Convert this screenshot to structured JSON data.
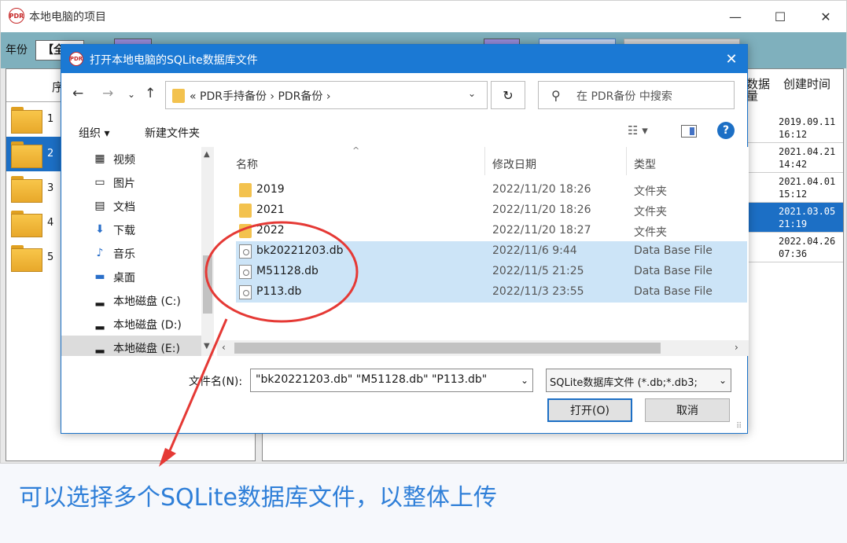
{
  "app": {
    "logo_text": "PDR",
    "title": "本地电脑的项目",
    "min_glyph": "—",
    "max_glyph": "☐",
    "close_glyph": "✕",
    "toolbar": {
      "year_label": "年份",
      "year_button": "【全"
    },
    "left_table": {
      "header_seq": "序",
      "rows": [
        {
          "num": "1"
        },
        {
          "num": "2"
        },
        {
          "num": "3"
        },
        {
          "num": "4"
        },
        {
          "num": "5"
        }
      ]
    },
    "right_table": {
      "header_col1": "数据量",
      "header_col2": "创建时间",
      "rows": [
        {
          "line1": "2019.09.11",
          "line2": "16:12"
        },
        {
          "line1": "2021.04.21",
          "line2": "14:42"
        },
        {
          "line1": "2021.04.01",
          "line2": "15:12"
        },
        {
          "line1": "2021.03.05",
          "line2": "21:19"
        },
        {
          "line1": "2022.04.26",
          "line2": "07:36"
        }
      ]
    }
  },
  "dialog": {
    "logo_text": "PDR",
    "title": "打开本地电脑的SQLite数据库文件",
    "close_glyph": "✕",
    "nav": {
      "back": "←",
      "forward": "→",
      "recent": "⌄",
      "up": "↑",
      "path": "«  PDR手持备份  ›  PDR备份  ›",
      "path_drop": "⌄",
      "refresh": "↻",
      "search_icon": "⚲",
      "search_placeholder": "在 PDR备份 中搜索"
    },
    "commands": {
      "organize": "组织 ▾",
      "new_folder": "新建文件夹",
      "view": "☷ ▾",
      "help": "?"
    },
    "nav_pane": {
      "scroll_up": "▲",
      "scroll_down": "▼",
      "items": [
        {
          "icon": "▦",
          "label": "视频"
        },
        {
          "icon": "▭",
          "label": "图片"
        },
        {
          "icon": "▤",
          "label": "文档"
        },
        {
          "icon": "⬇",
          "label": "下载"
        },
        {
          "icon": "♪",
          "label": "音乐"
        },
        {
          "icon": "▬",
          "label": "桌面"
        },
        {
          "icon": "▂",
          "label": "本地磁盘 (C:)"
        },
        {
          "icon": "▂",
          "label": "本地磁盘 (D:)"
        },
        {
          "icon": "▂",
          "label": "本地磁盘 (E:)"
        }
      ]
    },
    "file_list": {
      "sort_arrow": "^",
      "col_name": "名称",
      "col_date": "修改日期",
      "col_type": "类型",
      "rows": [
        {
          "name": "2019",
          "date": "2022/11/20 18:26",
          "type": "文件夹",
          "kind": "folder",
          "selected": false
        },
        {
          "name": "2021",
          "date": "2022/11/20 18:26",
          "type": "文件夹",
          "kind": "folder",
          "selected": false
        },
        {
          "name": "2022",
          "date": "2022/11/20 18:27",
          "type": "文件夹",
          "kind": "folder",
          "selected": false
        },
        {
          "name": "bk20221203.db",
          "date": "2022/11/6 9:44",
          "type": "Data Base File",
          "kind": "file",
          "selected": true
        },
        {
          "name": "M51128.db",
          "date": "2022/11/5 21:25",
          "type": "Data Base File",
          "kind": "file",
          "selected": true
        },
        {
          "name": "P113.db",
          "date": "2022/11/3 23:55",
          "type": "Data Base File",
          "kind": "file",
          "selected": true
        }
      ]
    },
    "hscroll": {
      "left": "‹",
      "right": "›"
    },
    "filename_label": "文件名(N):",
    "filename_value": "\"bk20221203.db\" \"M51128.db\" \"P113.db\"",
    "filename_drop": "⌄",
    "filter_value": "SQLite数据库文件 (*.db;*.db3;",
    "filter_drop": "⌄",
    "open_label": "打开(O)",
    "cancel_label": "取消",
    "grip": "⠿"
  },
  "annotation": {
    "caption": "可以选择多个SQLite数据库文件，以整体上传",
    "color": "#e53935",
    "caption_color": "#2f7fd8"
  }
}
